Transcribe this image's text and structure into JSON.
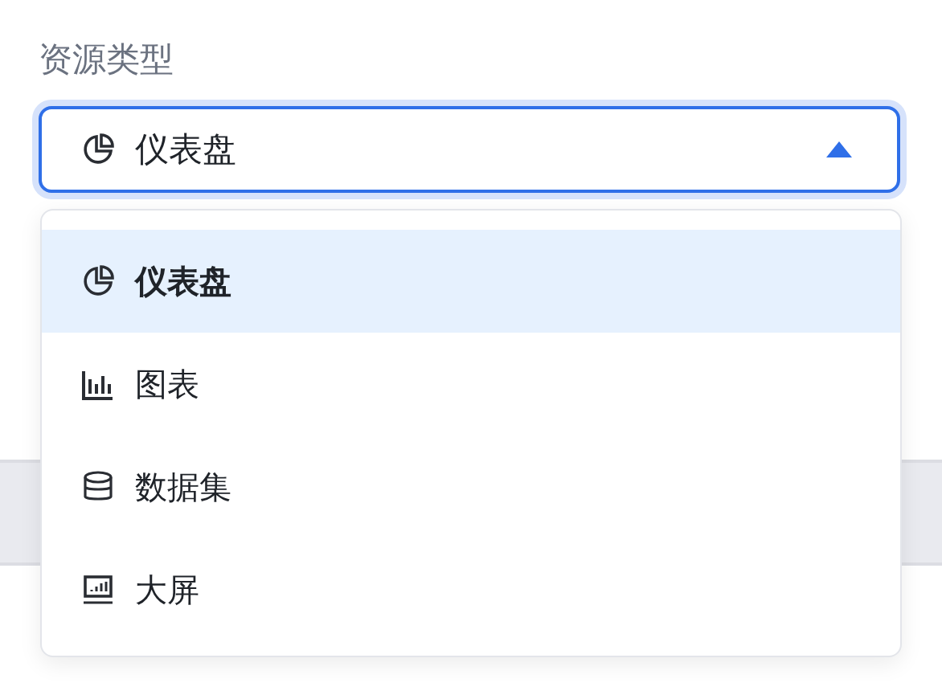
{
  "field": {
    "label": "资源类型",
    "value": {
      "kind": "pie",
      "text": "仪表盘"
    },
    "expanded": true
  },
  "options": [
    {
      "kind": "pie",
      "label": "仪表盘",
      "selected": true
    },
    {
      "kind": "bar",
      "label": "图表",
      "selected": false
    },
    {
      "kind": "database",
      "label": "数据集",
      "selected": false
    },
    {
      "kind": "screen",
      "label": "大屏",
      "selected": false
    }
  ]
}
